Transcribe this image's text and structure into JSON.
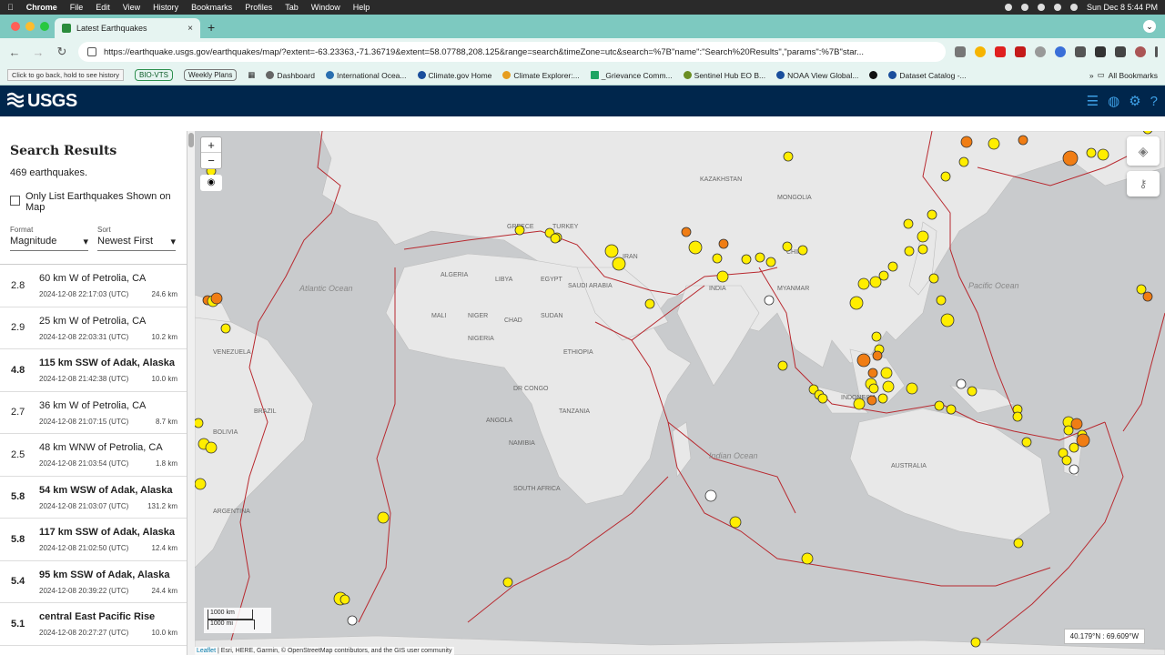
{
  "mac_menu": {
    "app": "Chrome",
    "items": [
      "File",
      "Edit",
      "View",
      "History",
      "Bookmarks",
      "Profiles",
      "Tab",
      "Window",
      "Help"
    ],
    "datetime": "Sun Dec 8  5:44 PM"
  },
  "tab": {
    "title": "Latest Earthquakes",
    "close": "×",
    "new": "+"
  },
  "toolbar": {
    "url": "https://earthquake.usgs.gov/earthquakes/map/?extent=-63.23363,-71.36719&extent=58.07788,208.125&range=search&timeZone=utc&search=%7B\"name\":\"Search%20Results\",\"params\":%7B\"star..."
  },
  "bookmarks": {
    "tooltip": "Click to go back, hold to see history",
    "bio_vts": "BIO-VTS",
    "weekly": "Weekly Plans",
    "items": [
      "Dashboard",
      "International Ocea...",
      "Climate.gov Home",
      "Climate Explorer:...",
      "_Grievance Comm...",
      "Sentinel Hub EO B...",
      "NOAA View Global...",
      "Dataset Catalog -..."
    ],
    "all": "All Bookmarks"
  },
  "usgs": {
    "logo": "USGS"
  },
  "sidebar": {
    "title": "Search Results",
    "count": "469 earthquakes.",
    "only_list": "Only List Earthquakes Shown on Map",
    "format_label": "Format",
    "format_value": "Magnitude",
    "sort_label": "Sort",
    "sort_value": "Newest First"
  },
  "earthquakes": [
    {
      "mag": "2.8",
      "place": "60 km W of Petrolia, CA",
      "time": "2024-12-08 22:17:03 (UTC)",
      "depth": "24.6 km",
      "bold": false
    },
    {
      "mag": "2.9",
      "place": "25 km W of Petrolia, CA",
      "time": "2024-12-08 22:03:31 (UTC)",
      "depth": "10.2 km",
      "bold": false
    },
    {
      "mag": "4.8",
      "place": "115 km SSW of Adak, Alaska",
      "time": "2024-12-08 21:42:38 (UTC)",
      "depth": "10.0 km",
      "bold": true
    },
    {
      "mag": "2.7",
      "place": "36 km W of Petrolia, CA",
      "time": "2024-12-08 21:07:15 (UTC)",
      "depth": "8.7 km",
      "bold": false
    },
    {
      "mag": "2.5",
      "place": "48 km WNW of Petrolia, CA",
      "time": "2024-12-08 21:03:54 (UTC)",
      "depth": "1.8 km",
      "bold": false
    },
    {
      "mag": "5.8",
      "place": "54 km WSW of Adak, Alaska",
      "time": "2024-12-08 21:03:07 (UTC)",
      "depth": "131.2 km",
      "bold": true
    },
    {
      "mag": "5.8",
      "place": "117 km SSW of Adak, Alaska",
      "time": "2024-12-08 21:02:50 (UTC)",
      "depth": "12.4 km",
      "bold": true
    },
    {
      "mag": "5.4",
      "place": "95 km SSW of Adak, Alaska",
      "time": "2024-12-08 20:39:22 (UTC)",
      "depth": "24.4 km",
      "bold": true
    },
    {
      "mag": "5.1",
      "place": "central East Pacific Rise",
      "time": "2024-12-08 20:27:27 (UTC)",
      "depth": "10.0 km",
      "bold": true
    }
  ],
  "map": {
    "zoom_in": "+",
    "zoom_out": "−",
    "scale_km": "1000 km",
    "scale_mi": "1000 mi",
    "coords": "40.179°N : 69.609°W",
    "attribution_leaflet": "Leaflet",
    "attribution": " | Esri, HERE, Garmin, © OpenStreetMap contributors, and the GIS user community",
    "labels": [
      {
        "text": "KAZAKHSTAN"
      },
      {
        "text": "MONGOLIA"
      },
      {
        "text": "TURKEY"
      },
      {
        "text": "GREECE"
      },
      {
        "text": "IRAN"
      },
      {
        "text": "CHINA"
      },
      {
        "text": "ALGERIA"
      },
      {
        "text": "LIBYA"
      },
      {
        "text": "EGYPT"
      },
      {
        "text": "SAUDI ARABIA"
      },
      {
        "text": "INDIA"
      },
      {
        "text": "MYANMAR"
      },
      {
        "text": "MALI"
      },
      {
        "text": "NIGER"
      },
      {
        "text": "CHAD"
      },
      {
        "text": "SUDAN"
      },
      {
        "text": "NIGERIA"
      },
      {
        "text": "ETHIOPIA"
      },
      {
        "text": "DR CONGO"
      },
      {
        "text": "TANZANIA"
      },
      {
        "text": "ANGOLA"
      },
      {
        "text": "NAMIBIA"
      },
      {
        "text": "SOUTH AFRICA"
      },
      {
        "text": "BRAZIL"
      },
      {
        "text": "BOLIVIA"
      },
      {
        "text": "ARGENTINA"
      },
      {
        "text": "VENEZUELA"
      },
      {
        "text": "AUSTRALIA"
      },
      {
        "text": "INDONESIA"
      },
      {
        "text": "Atlantic Ocean"
      },
      {
        "text": "Indian Ocean"
      },
      {
        "text": "Pacific Ocean"
      }
    ]
  },
  "colors": {
    "header": "#00264c",
    "tabstrip": "#7dc9c0",
    "quake_yellow": "#ffee00",
    "quake_orange": "#f07d14",
    "plate": "#b8292f",
    "land": "#e8e8e8",
    "ocean": "#c9cbcd"
  }
}
